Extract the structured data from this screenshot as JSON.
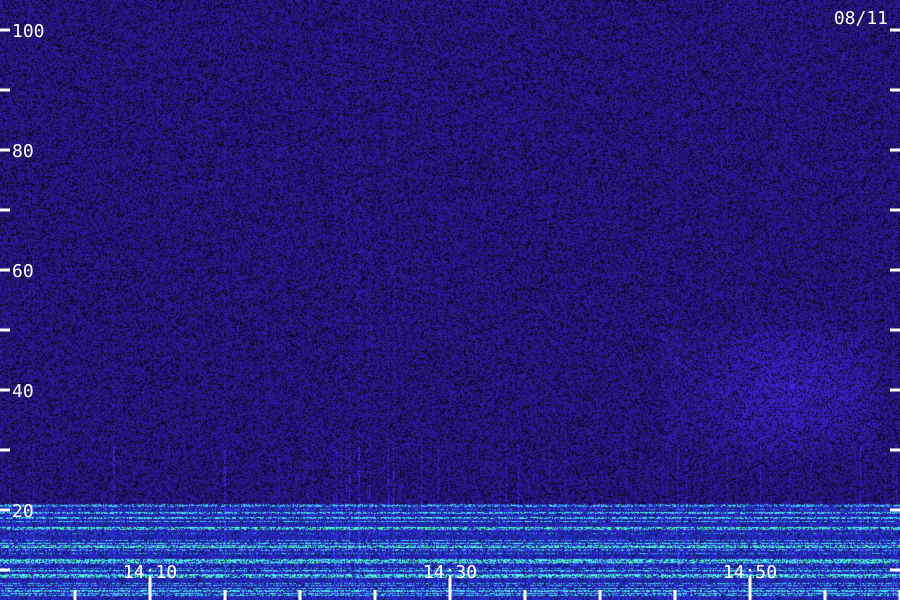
{
  "chart_data": {
    "type": "heatmap",
    "date_label": "08/11",
    "y_ticks": [
      {
        "value": 100,
        "label": "100"
      },
      {
        "value": 90,
        "label": ""
      },
      {
        "value": 80,
        "label": "80"
      },
      {
        "value": 70,
        "label": ""
      },
      {
        "value": 60,
        "label": "60"
      },
      {
        "value": 50,
        "label": ""
      },
      {
        "value": 40,
        "label": "40"
      },
      {
        "value": 30,
        "label": ""
      },
      {
        "value": 20,
        "label": "20"
      },
      {
        "value": 10,
        "label": ""
      }
    ],
    "x_ticks": [
      {
        "value": "14:05",
        "label": "",
        "major": false
      },
      {
        "value": "14:10",
        "label": "14:10",
        "major": true
      },
      {
        "value": "14:15",
        "label": "",
        "major": false
      },
      {
        "value": "14:20",
        "label": "",
        "major": false
      },
      {
        "value": "14:25",
        "label": "",
        "major": false
      },
      {
        "value": "14:30",
        "label": "14:30",
        "major": true
      },
      {
        "value": "14:35",
        "label": "",
        "major": false
      },
      {
        "value": "14:40",
        "label": "",
        "major": false
      },
      {
        "value": "14:45",
        "label": "",
        "major": false
      },
      {
        "value": "14:50",
        "label": "14:50",
        "major": true
      },
      {
        "value": "14:55",
        "label": "",
        "major": false
      },
      {
        "value": "15:00",
        "label": "",
        "major": false
      }
    ],
    "y_range": [
      5,
      105
    ],
    "x_range": [
      "14:00",
      "15:00"
    ],
    "colors": {
      "background": "#1a0a4a",
      "noise_low": "#0a0220",
      "noise_high": "#3a2cc0",
      "band_cyan": "#30e0f0",
      "band_green": "#40ff80",
      "tick": "#ffffff"
    }
  }
}
